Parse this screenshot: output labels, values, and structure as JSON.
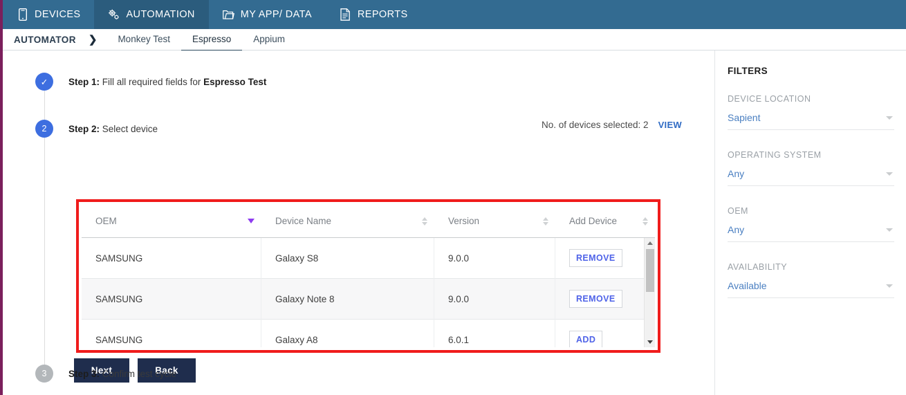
{
  "topnav": {
    "items": [
      {
        "label": "DEVICES",
        "icon": "phone-icon",
        "active": false
      },
      {
        "label": "AUTOMATION",
        "icon": "gear-icon",
        "active": true
      },
      {
        "label": "MY APP/ DATA",
        "icon": "folder-icon",
        "active": false
      },
      {
        "label": "REPORTS",
        "icon": "document-icon",
        "active": false
      }
    ],
    "background": "#336b91",
    "active_background": "#2b5c7d"
  },
  "subbar": {
    "crumb": "AUTOMATOR",
    "crumb_arrow": "❯",
    "tabs": [
      {
        "label": "Monkey Test",
        "active": false
      },
      {
        "label": "Espresso",
        "active": true
      },
      {
        "label": "Appium",
        "active": false
      }
    ]
  },
  "steps": [
    {
      "num": "✓",
      "state": "done",
      "label": "Step 1:",
      "text": " Fill all required fields for ",
      "bold_tail": "Espresso Test"
    },
    {
      "num": "2",
      "state": "active",
      "label": "Step 2:",
      "text": " Select device",
      "bold_tail": ""
    },
    {
      "num": "3",
      "state": "todo",
      "label": "Step 3:",
      "text": " Confirm test cycle",
      "bold_tail": ""
    }
  ],
  "device_summary": {
    "count_text": "No. of devices selected: 2",
    "view_label": "VIEW"
  },
  "table": {
    "columns": [
      {
        "label": "OEM",
        "sort": "desc"
      },
      {
        "label": "Device Name",
        "sort": "both"
      },
      {
        "label": "Version",
        "sort": "both"
      },
      {
        "label": "Add Device",
        "sort": "both"
      }
    ],
    "rows": [
      {
        "oem": "SAMSUNG",
        "device_name": "Galaxy S8",
        "version": "9.0.0",
        "action": "REMOVE"
      },
      {
        "oem": "SAMSUNG",
        "device_name": "Galaxy Note 8",
        "version": "9.0.0",
        "action": "REMOVE"
      },
      {
        "oem": "SAMSUNG",
        "device_name": "Galaxy A8",
        "version": "6.0.1",
        "action": "ADD"
      }
    ]
  },
  "buttons": {
    "next": "Next",
    "back": "Back"
  },
  "filters": {
    "title": "FILTERS",
    "groups": [
      {
        "label": "DEVICE LOCATION",
        "value": "Sapient"
      },
      {
        "label": "OPERATING SYSTEM",
        "value": "Any"
      },
      {
        "label": "OEM",
        "value": "Any"
      },
      {
        "label": "AVAILABILITY",
        "value": "Available"
      }
    ]
  },
  "colors": {
    "nav_blue": "#336b91",
    "accent_blue": "#3d6ee0",
    "link_blue": "#2f6bc4",
    "button_navy": "#1f2d4d",
    "highlight_red": "#f01c1c",
    "sort_purple": "#8e3cf0",
    "rail_purple": "#7b1f5c"
  }
}
